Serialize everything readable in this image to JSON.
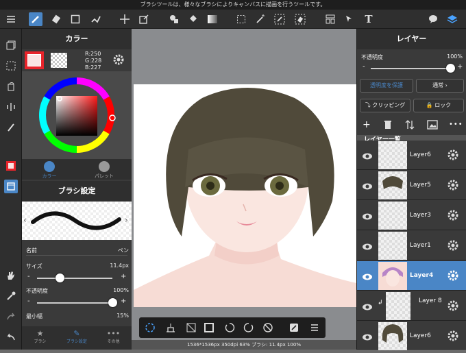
{
  "tooltip": "ブラシツールは、様々なブラシによりキャンバスに描画を行うツールです。",
  "toolbar_icons": [
    "menu-icon",
    "brush-icon",
    "eraser-icon",
    "rect-icon",
    "dot-brush-icon",
    "move-icon",
    "transform-icon",
    "fill-shape-icon",
    "bucket-icon",
    "gradient-icon",
    "select-rect-icon",
    "magic-wand-icon",
    "select-pen-icon",
    "select-eraser-icon",
    "layout-icon",
    "select-move-icon",
    "text-icon",
    "speech-icon",
    "layers-icon"
  ],
  "color_panel": {
    "title": "カラー",
    "rgb_r": "R:250",
    "rgb_g": "G:228",
    "rgb_b": "B:227",
    "tab_color": "カラー",
    "tab_palette": "パレット",
    "main_color": "#fae4e3"
  },
  "brush_panel": {
    "title": "ブラシ設定",
    "name_label": "名前",
    "name_value": "ペン",
    "size_label": "サイズ",
    "size_value": "11.4px",
    "size_level": 0.3,
    "opacity_label": "不透明度",
    "opacity_value": "100%",
    "opacity_level": 1.0,
    "minwidth_label": "最小幅",
    "minwidth_value": "15%",
    "tabs": [
      "ブラシ",
      "ブラシ設定",
      "その他"
    ]
  },
  "layer_panel": {
    "title": "レイヤー",
    "opacity_label": "不透明度",
    "opacity_value": "100%",
    "protect_label": "透明度を保護",
    "blend_label": "通常",
    "clip_label": "クリッピング",
    "lock_label": "ロック",
    "list_title": "レイヤー一覧",
    "layers": [
      "Layer6",
      "Layer5",
      "Layer3",
      "Layer1",
      "Layer4",
      "Layer 8",
      "Layer6"
    ]
  },
  "status": "1536*1536px 350dpi 63% ブラシ: 11.4px 100%",
  "colors": {
    "accent": "#4a86c6",
    "toolbar": "#2f2f2f",
    "panel": "#3a3a3a"
  }
}
